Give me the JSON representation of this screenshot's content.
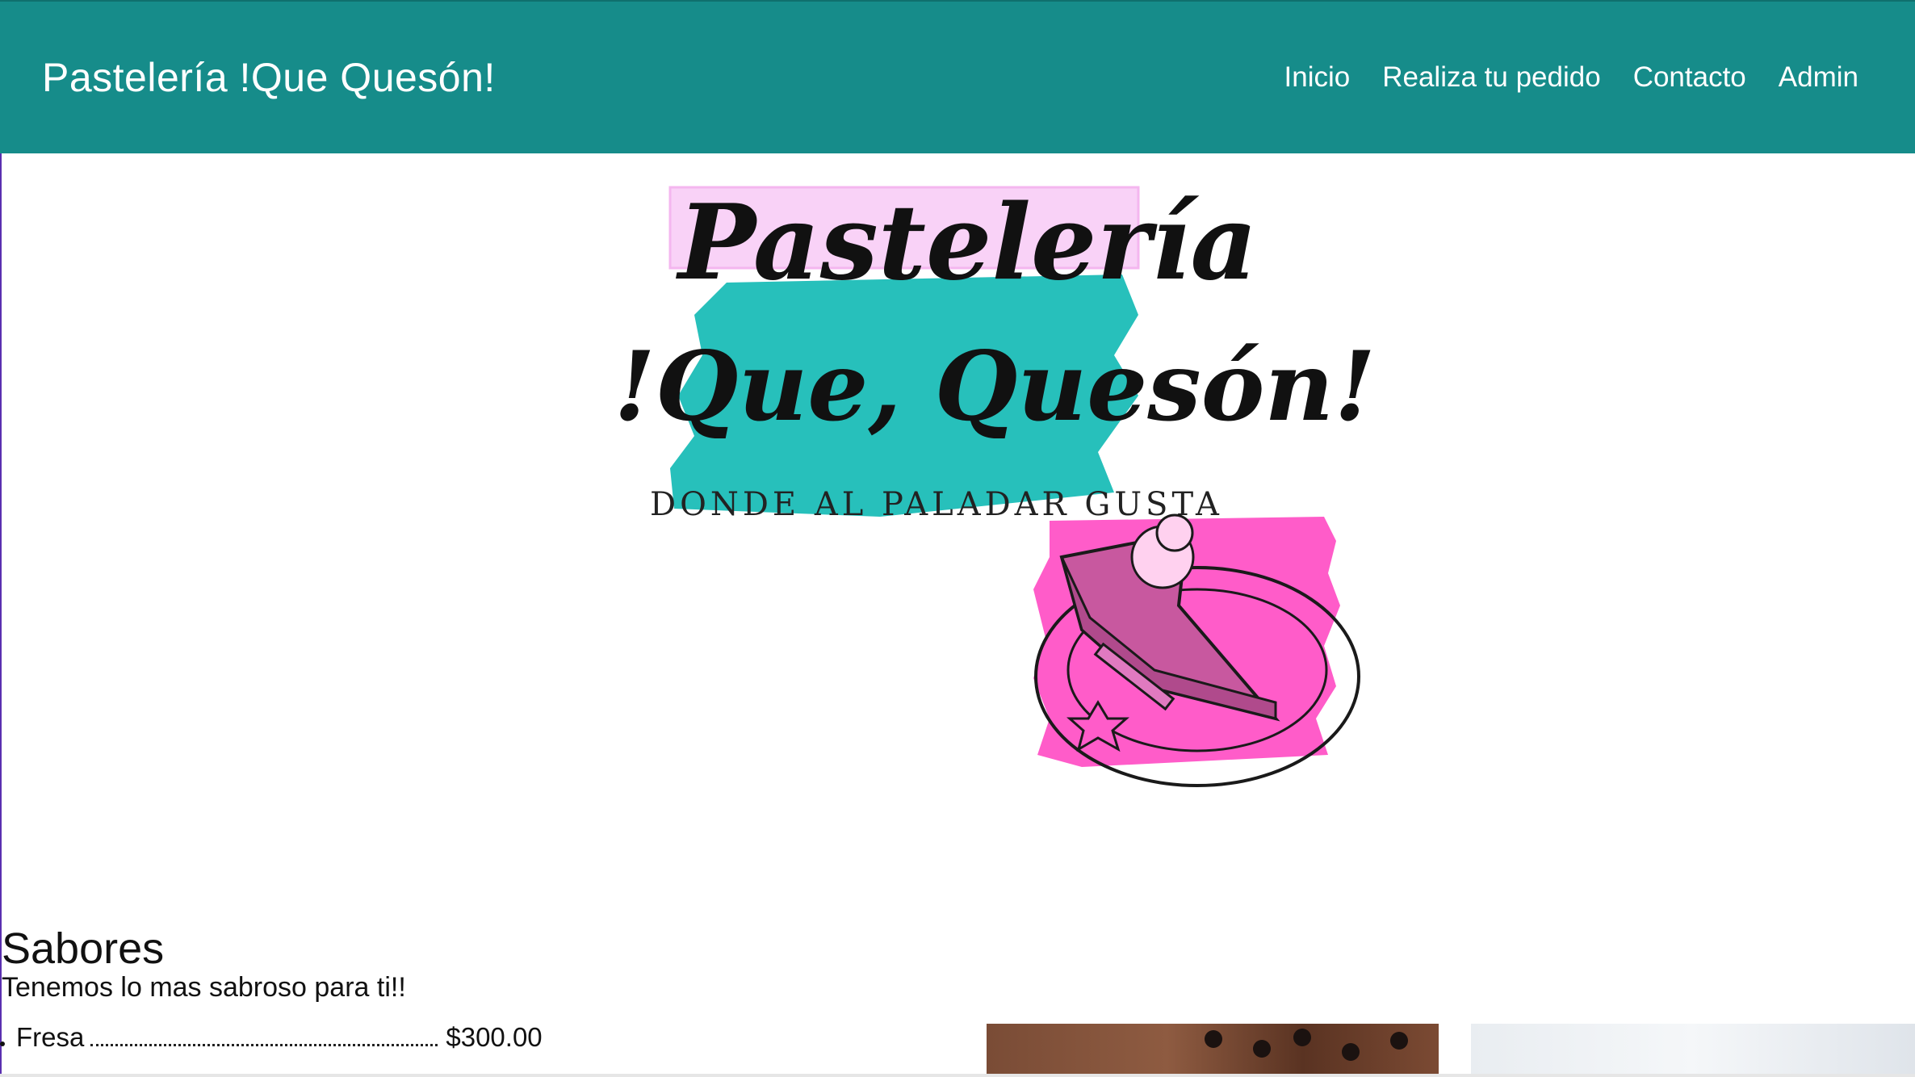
{
  "navbar": {
    "brand": "Pastelería !Que Quesón!",
    "links": [
      "Inicio",
      "Realiza tu pedido",
      "Contacto",
      "Admin"
    ]
  },
  "hero_logo": {
    "line1": "Pastelería",
    "line2": "!Que, Quesón!",
    "tagline": "DONDE AL PALADAR GUSTA",
    "colors": {
      "pink_light": "#f9d2f7",
      "teal": "#27c0bb",
      "pink": "#ff5cc9"
    }
  },
  "sabores": {
    "title": "Sabores",
    "subtitle": "Tenemos lo mas sabroso para ti!!",
    "items": [
      {
        "name": "Fresa",
        "price": "$300.00"
      }
    ]
  },
  "theme": {
    "primary": "#168c8a",
    "text": "#111111"
  }
}
